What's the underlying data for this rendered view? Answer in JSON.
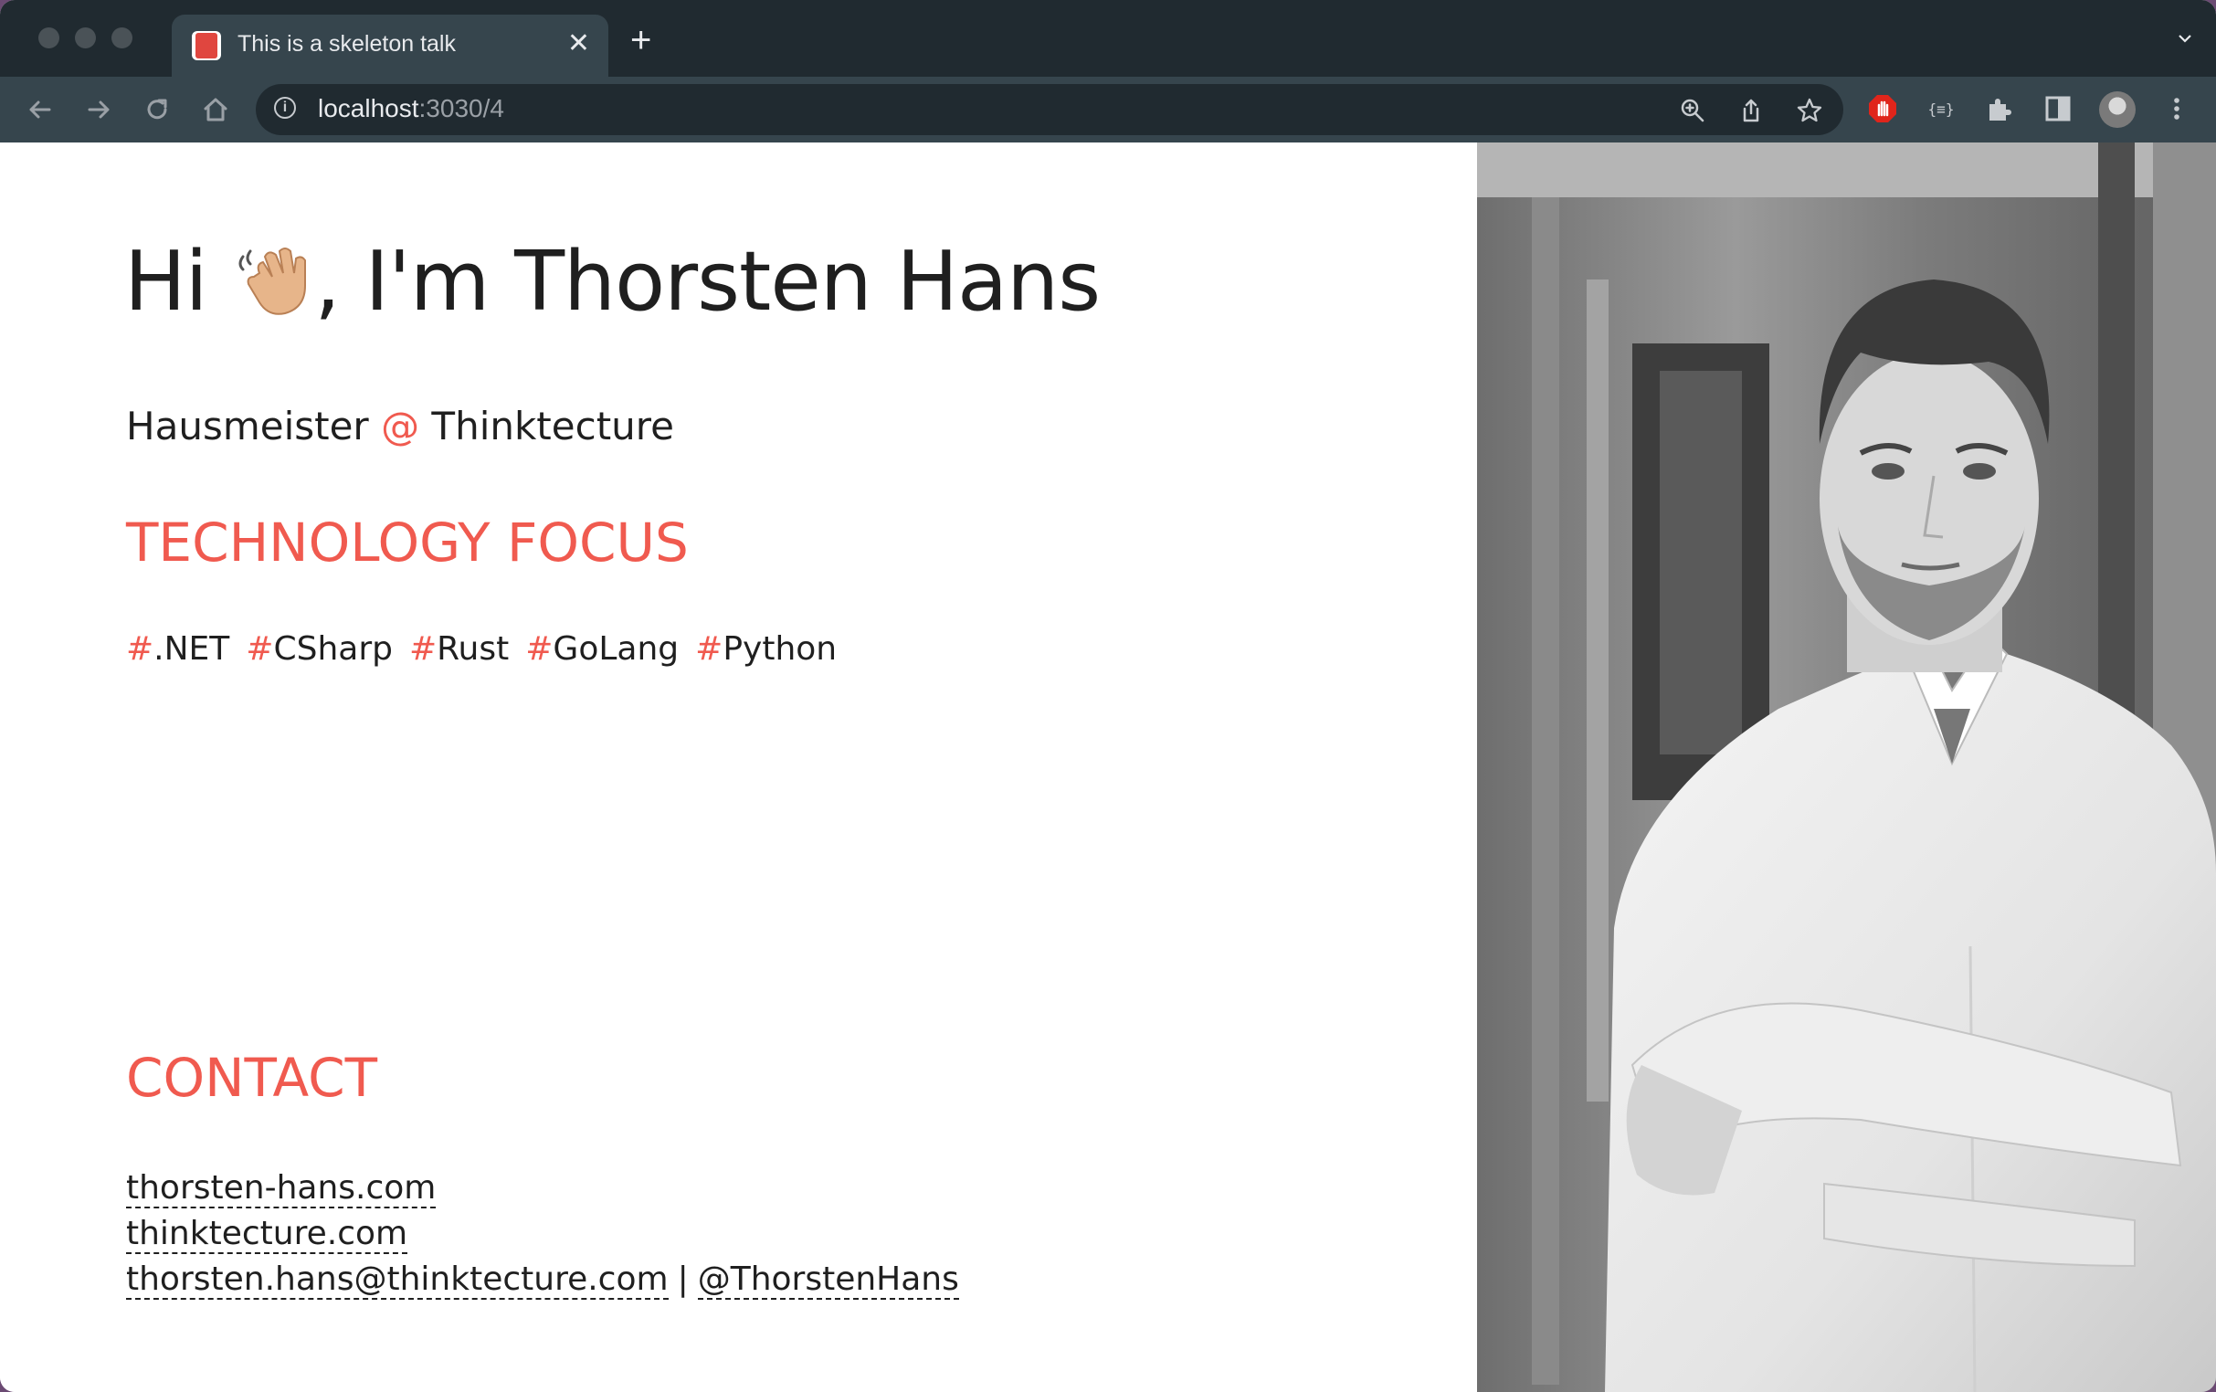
{
  "browser": {
    "tab_title": "This is a skeleton talk",
    "url_host": "localhost",
    "url_path": ":3030/4"
  },
  "slide": {
    "greeting_pre": "Hi ",
    "greeting_post": ", I'm Thorsten Hans",
    "role": "Hausmeister ",
    "at": "@",
    "company": " Thinktecture",
    "tech_title": "TECHNOLOGY FOCUS",
    "tags": [
      {
        "hash": "#",
        "label": ".NET"
      },
      {
        "hash": "#",
        "label": "CSharp"
      },
      {
        "hash": "#",
        "label": "Rust"
      },
      {
        "hash": "#",
        "label": "GoLang"
      },
      {
        "hash": "#",
        "label": "Python"
      }
    ],
    "contact_title": "CONTACT",
    "contacts": {
      "website": "thorsten-hans.com",
      "company_site": "thinktecture.com",
      "email": "thorsten.hans@thinktecture.com",
      "separator": "|",
      "twitter": "@ThorstenHans"
    }
  },
  "colors": {
    "accent": "#f05a4f",
    "tab_bar": "#202a30",
    "toolbar": "#36454d"
  }
}
